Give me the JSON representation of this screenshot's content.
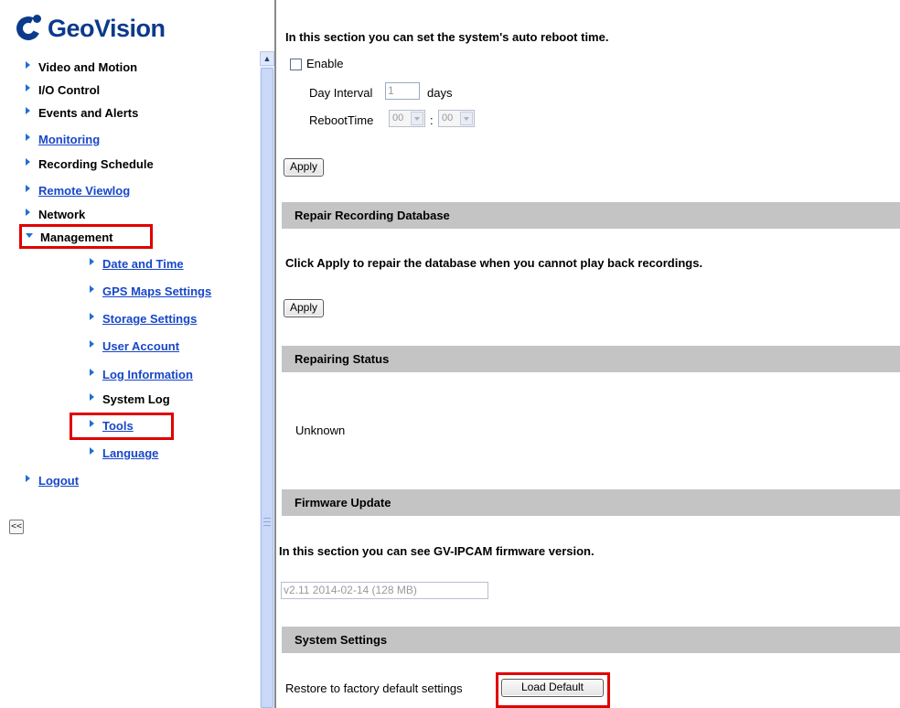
{
  "brand": {
    "name": "GeoVision"
  },
  "sidebar": {
    "items": [
      {
        "label": "Video and Motion"
      },
      {
        "label": "I/O Control"
      },
      {
        "label": "Events and Alerts"
      },
      {
        "label": "Monitoring"
      },
      {
        "label": "Recording Schedule"
      },
      {
        "label": "Remote Viewlog"
      },
      {
        "label": "Network"
      },
      {
        "label": "Management"
      },
      {
        "label": "Logout"
      }
    ],
    "management_items": [
      {
        "label": "Date and Time"
      },
      {
        "label": "GPS Maps Settings"
      },
      {
        "label": "Storage Settings"
      },
      {
        "label": "User Account"
      },
      {
        "label": "Log Information"
      },
      {
        "label": "System Log"
      },
      {
        "label": "Tools"
      },
      {
        "label": "Language"
      }
    ],
    "collapse_label": "<<"
  },
  "reboot": {
    "intro": "In this section you can set the system's auto reboot time.",
    "enable_label": "Enable",
    "day_interval_label": "Day Interval",
    "day_interval_value": "1",
    "days_label": "days",
    "reboot_time_label": "RebootTime",
    "hour_value": "00",
    "colon": ":",
    "minute_value": "00",
    "apply_label": "Apply"
  },
  "repair": {
    "title": "Repair Recording Database",
    "text": "Click Apply to repair the database when you cannot play back recordings.",
    "apply_label": "Apply"
  },
  "repair_status": {
    "title": "Repairing Status",
    "value": "Unknown"
  },
  "firmware": {
    "title": "Firmware Update",
    "text": "In this section you can see GV-IPCAM firmware version.",
    "version": "v2.11 2014-02-14 (128 MB)"
  },
  "system_settings": {
    "title": "System Settings",
    "restore_label": "Restore to factory default settings",
    "load_default_label": "Load Default"
  },
  "colors": {
    "highlight": "#e00000",
    "link": "#1847c8",
    "brand": "#0b3a8c",
    "section_bar": "#c4c4c4"
  }
}
